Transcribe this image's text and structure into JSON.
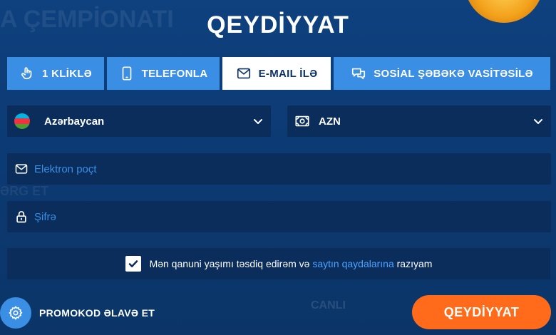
{
  "title": "QEYDİYYAT",
  "tabs": [
    {
      "label": "1 KLİKLƏ",
      "icon": "tap-finger-icon",
      "active": false
    },
    {
      "label": "TELEFONLA",
      "icon": "phone-icon",
      "active": false
    },
    {
      "label": "E-MAIL İLƏ",
      "icon": "envelope-icon",
      "active": true
    },
    {
      "label": "SOSİAL ŞƏBƏKƏ VASİTƏSİLƏ",
      "icon": "chat-bubbles-icon",
      "active": false
    }
  ],
  "country": {
    "value": "Azərbaycan",
    "icon": "azerbaijan-flag-icon"
  },
  "currency": {
    "value": "AZN",
    "icon": "banknote-icon"
  },
  "email": {
    "placeholder": "Elektron poçt",
    "icon": "envelope-icon"
  },
  "password": {
    "placeholder": "Şifrə",
    "icon": "lock-icon"
  },
  "agreement": {
    "checked": true,
    "text_before": "Mən qanuni yaşımı təsdiq edirəm və ",
    "link": "saytın qaydalarına",
    "text_after": " razıyam"
  },
  "promo": {
    "label": "PROMOKOD ƏLAVƏ ET",
    "icon": "gear-icon"
  },
  "submit": {
    "label": "QEYDİYYAT"
  },
  "colors": {
    "background": "#0e3a73",
    "field": "#0a2d5c",
    "tab": "#3a8ee3",
    "tab_active": "#ffffff",
    "link": "#4aa3ff",
    "submit": "#ff6b1a"
  }
}
